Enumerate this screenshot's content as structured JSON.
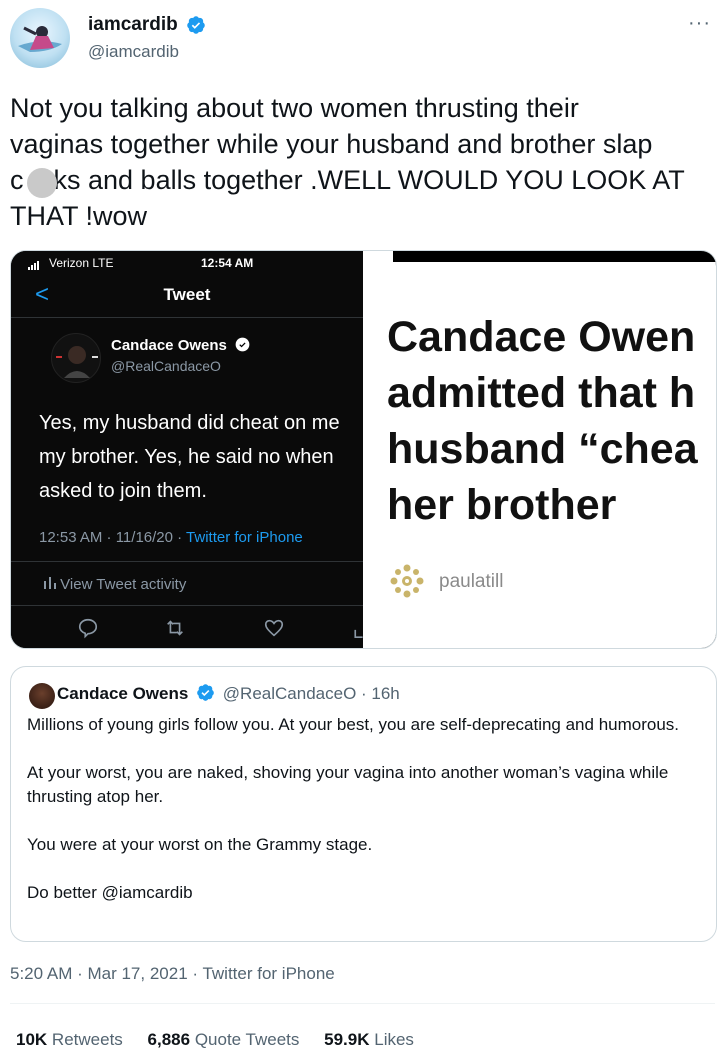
{
  "author": {
    "display_name": "iamcardib",
    "handle": "@iamcardib",
    "more_label": "···"
  },
  "tweet_text": "Not you talking about two women thrusting their\nvaginas together while your husband and brother slap\nc    ks and balls together .WELL WOULD YOU LOOK AT\nTHAT !wow",
  "media": {
    "phone": {
      "carrier": "Verizon  LTE",
      "time": "12:54 AM",
      "back": "<",
      "title": "Tweet",
      "name": "Candace Owens",
      "handle": "@RealCandaceO",
      "text": "Yes, my husband did cheat on me\nmy brother. Yes, he said no when\nasked to join them.",
      "date": "12:53 AM · 11/16/20 · ",
      "source": "Twitter for iPhone",
      "activity": "View Tweet activity"
    },
    "article": {
      "headline": "Candace Owen\nadmitted that h\nhusband “chea\nher brother",
      "brand": "paulatill"
    }
  },
  "quote": {
    "name": "Candace Owens",
    "handle_time": "@RealCandaceO · 16h",
    "paragraphs": [
      "Millions of young girls follow you. At your best, you are self-deprecating and humorous.",
      "At your worst, you are naked, shoving your vagina into another woman’s vagina while thrusting atop her.",
      "You were at your worst on the Grammy stage.",
      "Do better @iamcardib"
    ]
  },
  "timestamp": "5:20 AM · Mar 17, 2021 · Twitter for iPhone",
  "stats": [
    {
      "count": "10K",
      "label": "Retweets"
    },
    {
      "count": "6,886",
      "label": "Quote Tweets"
    },
    {
      "count": "59.9K",
      "label": "Likes"
    }
  ],
  "colors": {
    "accent": "#1d9bf0",
    "text": "#0f1419",
    "secondary": "#536471",
    "border": "#cfd9de"
  },
  "icons": [
    "verified-badge-icon",
    "more-icon",
    "back-chevron-icon",
    "reply-icon",
    "retweet-icon",
    "like-icon",
    "share-icon",
    "bar-chart-icon",
    "signal-icon",
    "brand-mandala-icon"
  ]
}
